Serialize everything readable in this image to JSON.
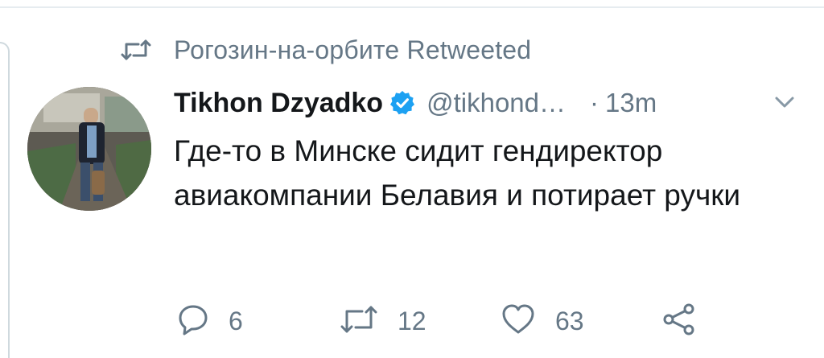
{
  "context": {
    "retweet_label": "Рогозин-на-орбите Retweeted",
    "retweet_icon": "retweet-icon"
  },
  "tweet": {
    "author_name": "Tikhon Dzyadko",
    "verified": true,
    "handle": "@tikhond…",
    "separator": "·",
    "timestamp": "13m",
    "text": "Где-то в Минске сидит гендиректор авиакомпании Белавия и потирает ручки"
  },
  "actions": {
    "reply_count": "6",
    "retweet_count": "12",
    "like_count": "63"
  },
  "colors": {
    "text_primary": "#14171a",
    "text_secondary": "#657786",
    "verified_blue": "#1da1f2",
    "divider": "#e6ecf0"
  }
}
